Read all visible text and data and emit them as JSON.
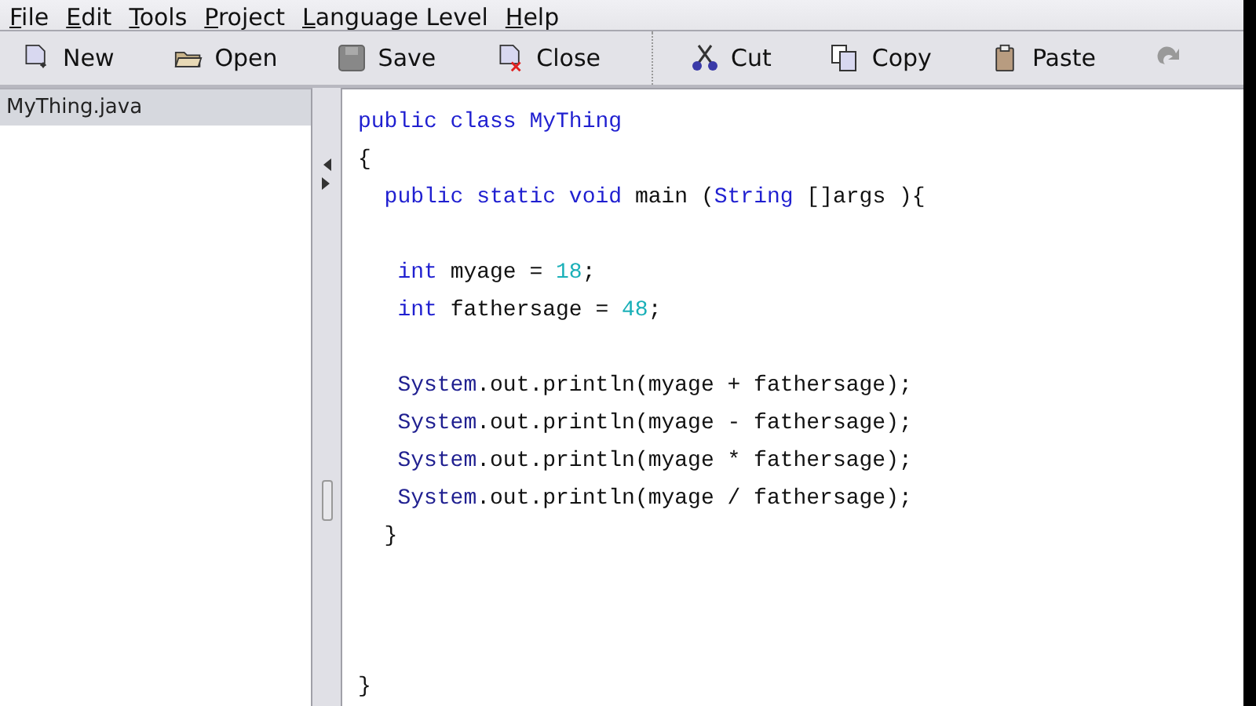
{
  "menu": [
    "File",
    "Edit",
    "Tools",
    "Project",
    "Language Level",
    "Help"
  ],
  "toolbar": [
    {
      "label": "New"
    },
    {
      "label": "Open"
    },
    {
      "label": "Save"
    },
    {
      "label": "Close"
    },
    {
      "kind": "separator"
    },
    {
      "label": "Cut"
    },
    {
      "label": "Copy"
    },
    {
      "label": "Paste"
    },
    {
      "kind": "icon"
    }
  ],
  "files": [
    {
      "name": "MyThing.java",
      "selected": true
    }
  ],
  "code_blocks": [
    [
      [
        {
          "t": "public class ",
          "kind": "keyword"
        },
        {
          "t": "MyThing",
          "kind": "keyword"
        }
      ],
      [
        {
          "t": "{",
          "kind": "plain"
        }
      ],
      [
        {
          "t": "  public static void ",
          "kind": "keyword"
        },
        {
          "t": "main (",
          "kind": "plain"
        },
        {
          "t": "String",
          "kind": "keyword"
        },
        {
          "t": " []args ){",
          "kind": "plain"
        }
      ]
    ],
    [
      [
        {
          "t": "   int ",
          "kind": "keyword"
        },
        {
          "t": "myage = ",
          "kind": "plain"
        },
        {
          "t": "18",
          "kind": "number"
        },
        {
          "t": ";",
          "kind": "plain"
        }
      ],
      [
        {
          "t": "   int ",
          "kind": "keyword"
        },
        {
          "t": "fathersage = ",
          "kind": "plain"
        },
        {
          "t": "48",
          "kind": "number"
        },
        {
          "t": ";",
          "kind": "plain"
        }
      ]
    ],
    [
      [
        {
          "t": "   System",
          "kind": "type"
        },
        {
          "t": ".out.println(myage + fathersage);",
          "kind": "plain"
        }
      ],
      [
        {
          "t": "   System",
          "kind": "type"
        },
        {
          "t": ".out.println(myage - fathersage);",
          "kind": "plain"
        }
      ],
      [
        {
          "t": "   System",
          "kind": "type"
        },
        {
          "t": ".out.println(myage * fathersage);",
          "kind": "plain"
        }
      ],
      [
        {
          "t": "   System",
          "kind": "type"
        },
        {
          "t": ".out.println(myage / fathersage);",
          "kind": "plain"
        }
      ],
      [
        {
          "t": "  }",
          "kind": "plain"
        }
      ]
    ],
    [
      [
        {
          "t": "}",
          "kind": "plain"
        }
      ]
    ]
  ]
}
